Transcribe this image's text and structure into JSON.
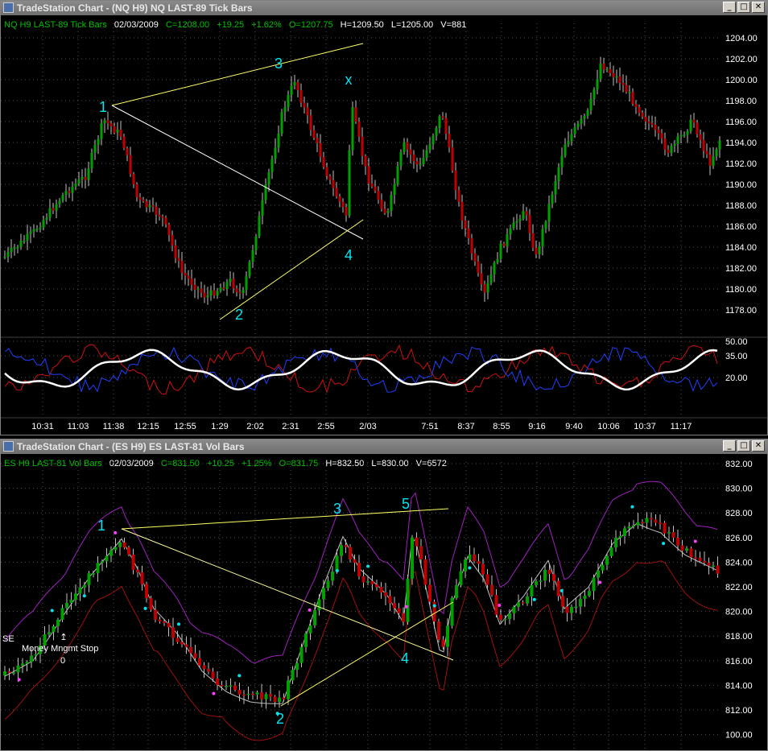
{
  "top": {
    "title": "TradeStation Chart - (NQ H9) NQ LAST-89 Tick Bars",
    "symbol": "NQ H9 LAST-89 Tick Bars",
    "date": "02/03/2009",
    "close": "C=1208.00",
    "change": "+19.25",
    "pct": "+1.62%",
    "open": "O=1207.75",
    "high": "H=1209.50",
    "low": "L=1205.00",
    "vol": "V=881",
    "price_axis": [
      "1204.00",
      "1202.00",
      "1200.00",
      "1198.00",
      "1196.00",
      "1194.00",
      "1192.00",
      "1190.00",
      "1188.00",
      "1186.00",
      "1184.00",
      "1182.00",
      "1180.00",
      "1178.00"
    ],
    "osc_axis": [
      "50.00",
      "35.00",
      "20.00"
    ],
    "time_axis": [
      "10:31",
      "11:03",
      "11:38",
      "12:15",
      "12:55",
      "1:29",
      "2:02",
      "2:31",
      "2:55",
      "2/03",
      "7:51",
      "8:37",
      "8:55",
      "9:16",
      "9:40",
      "10:06",
      "10:37",
      "11:17"
    ],
    "labels": {
      "p1": "1",
      "p2": "2",
      "p3": "3",
      "p4": "4",
      "px": "x"
    }
  },
  "bottom": {
    "title": "TradeStation Chart - (ES H9) ES LAST-81 Vol Bars",
    "symbol": "ES H9 LAST-81 Vol Bars",
    "date": "02/03/2009",
    "close": "C=831.50",
    "change": "+10.25",
    "pct": "+1.25%",
    "open": "O=831.75",
    "high": "H=832.50",
    "low": "L=830.00",
    "vol": "V=6572",
    "price_axis": [
      "832.00",
      "830.00",
      "828.00",
      "826.00",
      "824.00",
      "822.00",
      "820.00",
      "818.00",
      "816.00",
      "814.00",
      "812.00",
      "100.00"
    ],
    "labels": {
      "p1": "1",
      "p2": "2",
      "p3": "3",
      "p4": "4",
      "p5": "5"
    },
    "note_se": "SE",
    "note_stop": "Money Mngmt Stop",
    "note_zero": "0"
  },
  "colors": {
    "up": "#00a000",
    "down": "#c00000",
    "wick": "#c0c0c0",
    "trend": "#ffff66",
    "white_trend": "#ffffff",
    "annot": "#00e5ee",
    "header_green": "#00c000",
    "grid": "#505050"
  },
  "icons": {
    "minimize": "minimize-icon",
    "restore": "restore-icon",
    "close": "close-icon"
  }
}
